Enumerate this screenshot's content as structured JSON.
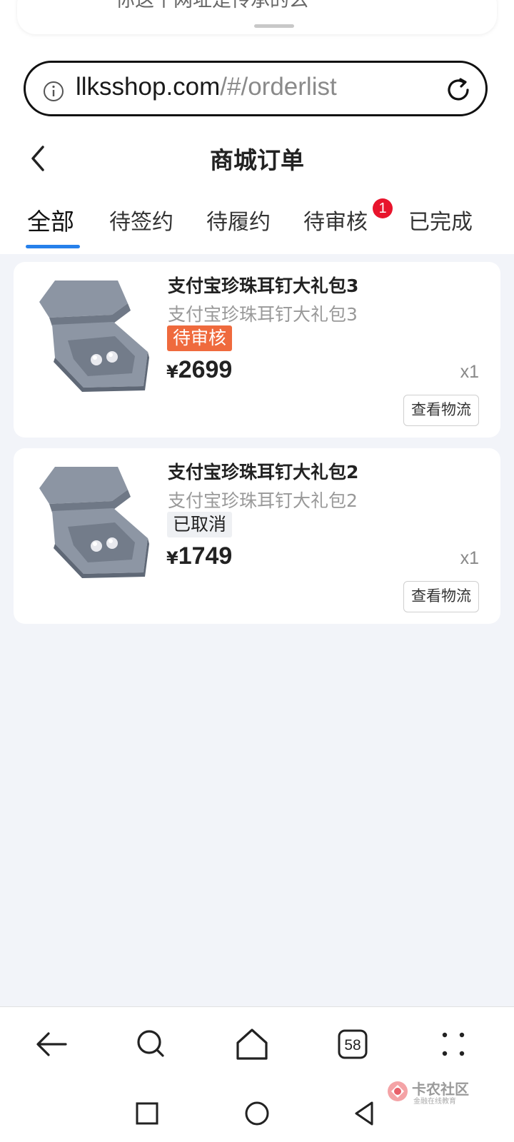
{
  "notification": {
    "text": "你这个网址是传承的么",
    "app_icon": "wechat-icon"
  },
  "address_bar": {
    "host": "llksshop.com",
    "path": "/#/orderlist",
    "left_icon": "info-icon",
    "right_icon": "reload-icon"
  },
  "header": {
    "title": "商城订单",
    "back_icon": "chevron-left-icon"
  },
  "tabs": {
    "items": [
      {
        "label": "全部",
        "active": true
      },
      {
        "label": "待签约",
        "active": false
      },
      {
        "label": "待履约",
        "active": false
      },
      {
        "label": "待审核",
        "active": false,
        "badge": "1"
      },
      {
        "label": "已完成",
        "active": false
      }
    ],
    "accent_color": "#2680eb",
    "badge_color": "#e8142c"
  },
  "orders": [
    {
      "name": "支付宝珍珠耳钉大礼包3",
      "subtitle": "支付宝珍珠耳钉大礼包3",
      "status": "待审核",
      "status_color": "#ef6a3d",
      "currency": "¥",
      "price": "2699",
      "quantity": "x1",
      "action": "查看物流"
    },
    {
      "name": "支付宝珍珠耳钉大礼包2",
      "subtitle": "支付宝珍珠耳钉大礼包2",
      "status": "已取消",
      "status_color": "#eef0f3",
      "currency": "¥",
      "price": "1749",
      "quantity": "x1",
      "action": "查看物流"
    }
  ],
  "browser_toolbar": {
    "buttons": [
      "back-arrow-icon",
      "search-icon",
      "home-icon",
      "tabs-icon",
      "more-icon"
    ],
    "tab_count": "58"
  },
  "system_nav": {
    "buttons": [
      "recents-square-icon",
      "home-circle-icon",
      "back-triangle-icon"
    ]
  },
  "watermark": {
    "title": "卡农社区",
    "subtitle": "金融在线教育"
  }
}
